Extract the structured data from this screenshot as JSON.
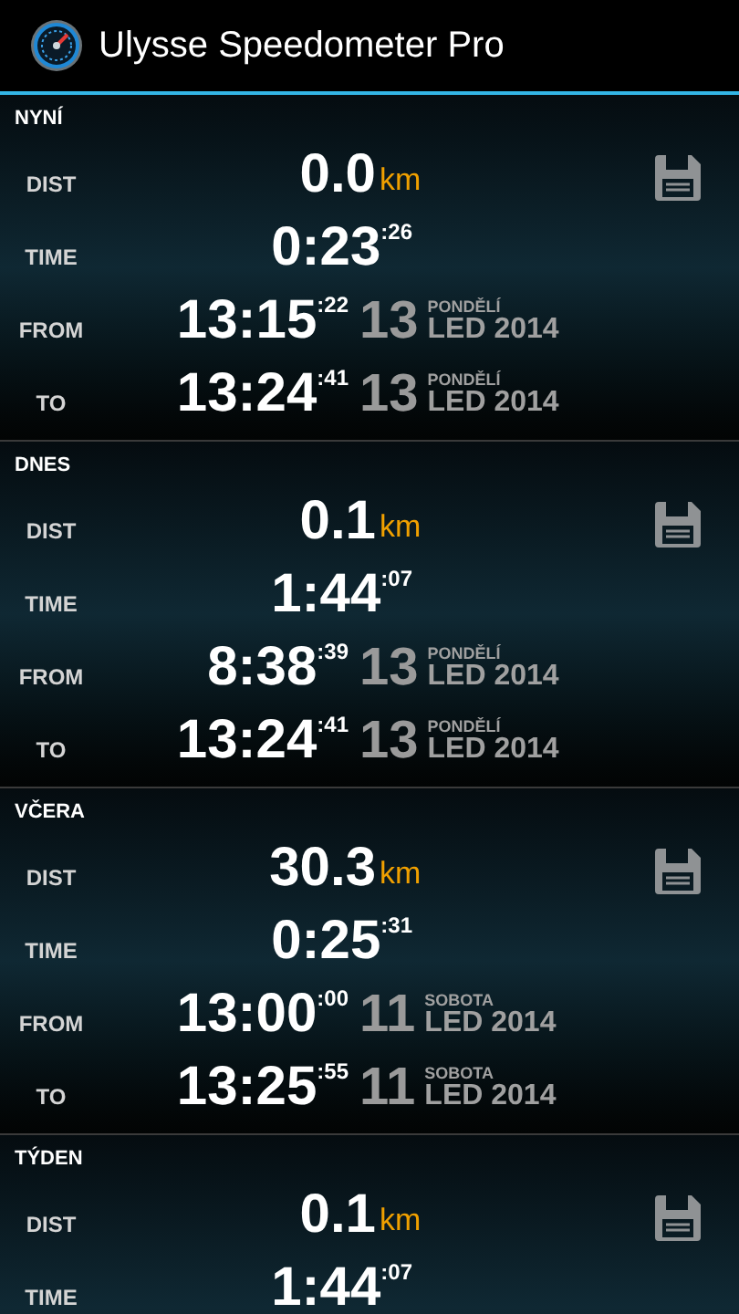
{
  "action_bar": {
    "title": "Ulysse Speedometer Pro"
  },
  "sections": [
    {
      "title": "NYNÍ",
      "rows": [
        {
          "kind": "dist",
          "label": "DIST",
          "value": "0.0",
          "unit": "km"
        },
        {
          "kind": "time",
          "label": "TIME",
          "main": "0:23",
          "seconds": ":26"
        },
        {
          "kind": "datetime",
          "label": "FROM",
          "main": "13:15",
          "seconds": ":22",
          "day": "13",
          "weekday": "PONDĚLÍ",
          "month_year": "LED 2014"
        },
        {
          "kind": "datetime",
          "label": "TO",
          "main": "13:24",
          "seconds": ":41",
          "day": "13",
          "weekday": "PONDĚLÍ",
          "month_year": "LED 2014"
        }
      ]
    },
    {
      "title": "DNES",
      "rows": [
        {
          "kind": "dist",
          "label": "DIST",
          "value": "0.1",
          "unit": "km"
        },
        {
          "kind": "time",
          "label": "TIME",
          "main": "1:44",
          "seconds": ":07"
        },
        {
          "kind": "datetime",
          "label": "FROM",
          "main": "8:38",
          "seconds": ":39",
          "day": "13",
          "weekday": "PONDĚLÍ",
          "month_year": "LED 2014"
        },
        {
          "kind": "datetime",
          "label": "TO",
          "main": "13:24",
          "seconds": ":41",
          "day": "13",
          "weekday": "PONDĚLÍ",
          "month_year": "LED 2014"
        }
      ]
    },
    {
      "title": "VČERA",
      "rows": [
        {
          "kind": "dist",
          "label": "DIST",
          "value": "30.3",
          "unit": "km"
        },
        {
          "kind": "time",
          "label": "TIME",
          "main": "0:25",
          "seconds": ":31"
        },
        {
          "kind": "datetime",
          "label": "FROM",
          "main": "13:00",
          "seconds": ":00",
          "day": "11",
          "weekday": "SOBOTA",
          "month_year": "LED 2014"
        },
        {
          "kind": "datetime",
          "label": "TO",
          "main": "13:25",
          "seconds": ":55",
          "day": "11",
          "weekday": "SOBOTA",
          "month_year": "LED 2014"
        }
      ]
    },
    {
      "title": "TÝDEN",
      "rows": [
        {
          "kind": "dist",
          "label": "DIST",
          "value": "0.1",
          "unit": "km"
        },
        {
          "kind": "time",
          "label": "TIME",
          "main": "1:44",
          "seconds": ":07"
        }
      ]
    }
  ]
}
